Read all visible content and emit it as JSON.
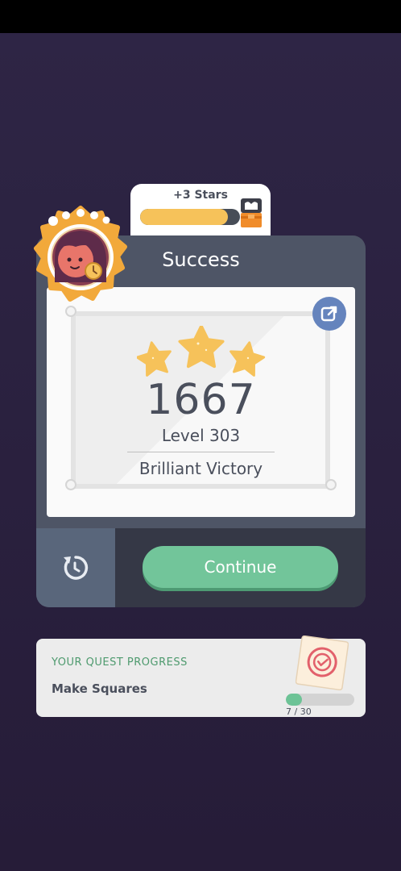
{
  "stars_reward": {
    "label": "+3 Stars",
    "progress_fraction": 0.88
  },
  "result": {
    "title": "Success",
    "score": "1667",
    "level": "Level 303",
    "rating": "Brilliant Victory",
    "stars_earned": 3
  },
  "actions": {
    "continue_label": "Continue"
  },
  "quest": {
    "heading": "YOUR QUEST PROGRESS",
    "name": "Make Squares",
    "progress_text": "7 / 30",
    "progress_fraction": 0.2333
  },
  "colors": {
    "background": "#2a1f3d",
    "card": "#4e5566",
    "accent_green": "#72c59a",
    "star_yellow": "#f6c25a",
    "share_blue": "#6584bd"
  },
  "icons": [
    "share-icon",
    "star-icon",
    "retry-icon",
    "chest-icon",
    "quest-stamp-icon",
    "avatar-badge"
  ]
}
